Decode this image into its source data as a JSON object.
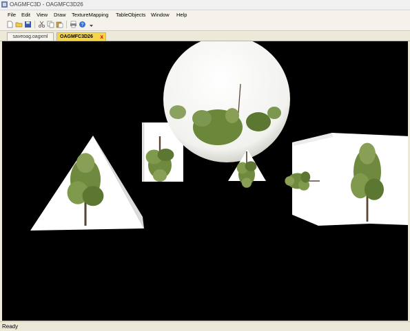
{
  "window": {
    "title": "OAGMFC3D - OAGMFC3D26"
  },
  "menu": {
    "items": [
      "File",
      "Edit",
      "View",
      "Draw",
      "TextureMapping",
      "TableObjects",
      "Window",
      "Help"
    ]
  },
  "toolbar": {
    "buttons": [
      "new-icon",
      "open-icon",
      "save-icon",
      "cut-icon",
      "copy-icon",
      "paste-icon",
      "print-icon",
      "help-icon"
    ]
  },
  "tabs": [
    {
      "label": "saveoag.oagxml",
      "active": false
    },
    {
      "label": "OAGMFC3D26",
      "active": true,
      "close": "x"
    }
  ],
  "scene": {
    "background": "#000000",
    "objects": [
      "pyramid",
      "cylinder",
      "sphere",
      "cone",
      "cube"
    ],
    "texture": "tree"
  },
  "status": {
    "text": "Ready"
  }
}
